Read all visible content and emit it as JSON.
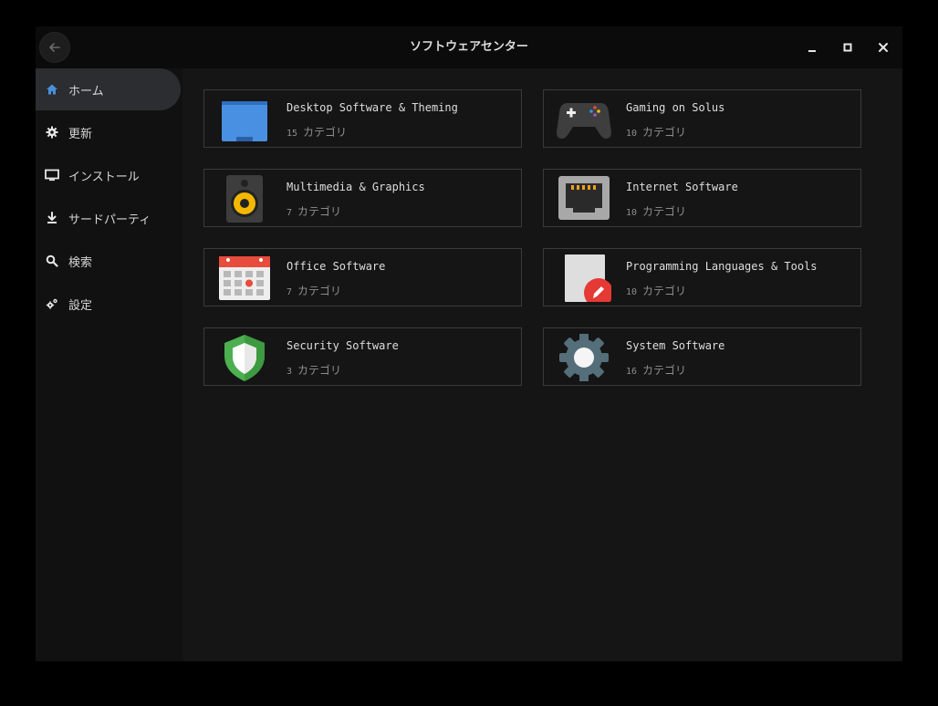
{
  "window": {
    "title": "ソフトウェアセンター"
  },
  "titlebar": {
    "controls": [
      {
        "name": "minimize-icon"
      },
      {
        "name": "maximize-icon"
      },
      {
        "name": "close-icon"
      }
    ]
  },
  "sidebar": {
    "items": [
      {
        "label": "ホーム",
        "icon": "home-icon",
        "active": true
      },
      {
        "label": "更新",
        "icon": "update-gear-icon",
        "active": false
      },
      {
        "label": "インストール",
        "icon": "monitor-icon",
        "active": false
      },
      {
        "label": "サードパーティ",
        "icon": "download-icon",
        "active": false
      },
      {
        "label": "検索",
        "icon": "search-icon",
        "active": false
      },
      {
        "label": "設定",
        "icon": "settings-icon",
        "active": false
      }
    ]
  },
  "categories": [
    {
      "title": "Desktop Software & Theming",
      "count": "15",
      "suffix": "カテゴリ",
      "icon": "desktop-folder-icon"
    },
    {
      "title": "Gaming on Solus",
      "count": "10",
      "suffix": "カテゴリ",
      "icon": "gamepad-icon"
    },
    {
      "title": "Multimedia & Graphics",
      "count": "7",
      "suffix": "カテゴリ",
      "icon": "speaker-icon"
    },
    {
      "title": "Internet Software",
      "count": "10",
      "suffix": "カテゴリ",
      "icon": "network-port-icon"
    },
    {
      "title": "Office Software",
      "count": "7",
      "suffix": "カテゴリ",
      "icon": "calendar-icon"
    },
    {
      "title": "Programming Languages & Tools",
      "count": "10",
      "suffix": "カテゴリ",
      "icon": "edit-document-icon"
    },
    {
      "title": "Security Software",
      "count": "3",
      "suffix": "カテゴリ",
      "icon": "shield-icon"
    },
    {
      "title": "System Software",
      "count": "16",
      "suffix": "カテゴリ",
      "icon": "system-gear-icon"
    }
  ],
  "colors": {
    "background": "#151515",
    "sidebar": "#111111",
    "sidebar_active": "#2b2d30",
    "accent_home": "#4a90d9",
    "card_border": "#3a3a3a"
  }
}
